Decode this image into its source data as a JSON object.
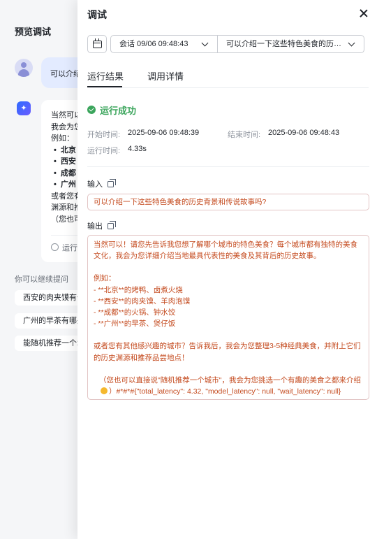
{
  "background": {
    "title": "预览调试",
    "user_message": "可以介绍一下",
    "bot_icon": "sparkle-icon",
    "bot_lines": [
      "当然可以",
      "我会为您",
      "例如："
    ],
    "bot_list": [
      "北京",
      "西安",
      "成都",
      "广州"
    ],
    "bot_tail": [
      "或者您有",
      "渊源和推",
      "（您也可"
    ],
    "run_text": "运行",
    "follow_label": "你可以继续提问",
    "suggestions": [
      "西安的肉夹馍有什么",
      "广州的早茶有哪些",
      "能随机推荐一个城"
    ]
  },
  "panel": {
    "title": "调试",
    "session_select": "会话 09/06 09:48:43",
    "question_select": "可以介绍一下这些特色美食的历史背景和传说故事吗？",
    "tabs": [
      "运行结果",
      "调用详情"
    ],
    "status": "运行成功",
    "status_color": "#3ba55c",
    "start_label": "开始时间:",
    "start_value": "2025-09-06 09:48:39",
    "end_label": "结束时间:",
    "end_value": "2025-09-06 09:48:43",
    "duration_label": "运行时间:",
    "duration_value": "4.33s",
    "input_label": "输入",
    "input_value": "可以介绍一下这些特色美食的历史背景和传说故事吗?",
    "output_label": "输出",
    "output": {
      "p1": "当然可以！请您先告诉我您想了解哪个城市的特色美食？每个城市都有独特的美食文化，我会为您详细介绍当地最具代表性的美食及其背后的历史故事。",
      "p2": "例如：\n- **北京**的烤鸭、卤煮火烧\n- **西安**的肉夹馍、羊肉泡馍\n- **成都**的火锅、钟水饺\n- **广州**的早茶、煲仔饭",
      "p3": "或者您有其他感兴趣的城市？告诉我后，我会为您整理3-5种经典美食，并附上它们的历史渊源和推荐品尝地点！",
      "p4_a": "（您也可以直接说\"随机推荐一个城市\"，我会为您挑选一个有趣的美食之都来介绍",
      "p4_b": "）#*#*#{\"total_latency\": 4.32, \"model_latency\": null, \"wait_latency\": null}"
    },
    "text_accent": "#c44a1e"
  }
}
